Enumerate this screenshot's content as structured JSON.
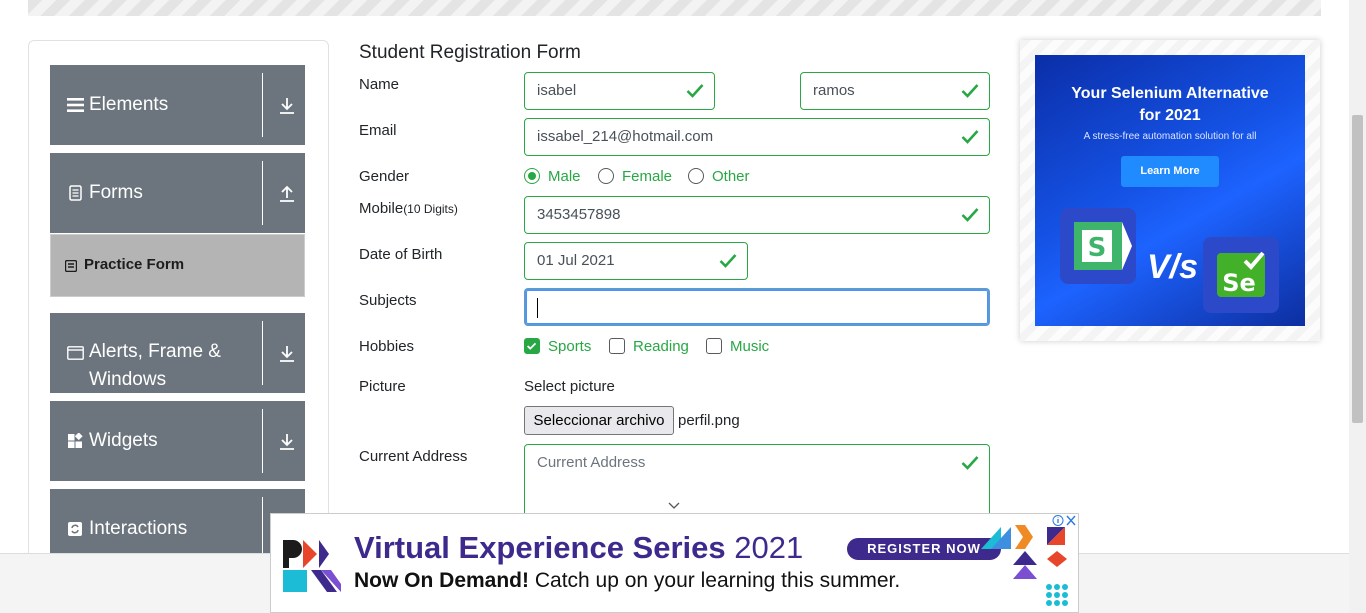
{
  "form": {
    "title": "Student Registration Form",
    "name_label": "Name",
    "first_name": "isabel",
    "last_name": "ramos",
    "email_label": "Email",
    "email": "issabel_214@hotmail.com",
    "gender_label": "Gender",
    "gender_options": [
      "Male",
      "Female",
      "Other"
    ],
    "gender_selected": "Male",
    "mobile_label": "Mobile",
    "mobile_hint": "(10 Digits)",
    "mobile": "3453457898",
    "dob_label": "Date of Birth",
    "dob": "01 Jul 2021",
    "subjects_label": "Subjects",
    "subjects_value": "",
    "hobbies_label": "Hobbies",
    "hobbies": [
      {
        "label": "Sports",
        "checked": true
      },
      {
        "label": "Reading",
        "checked": false
      },
      {
        "label": "Music",
        "checked": false
      }
    ],
    "picture_label": "Picture",
    "select_picture": "Select picture",
    "file_button": "Seleccionar archivo",
    "file_name": "perfil.png",
    "address_label": "Current Address",
    "address_placeholder": "Current Address"
  },
  "sidebar": {
    "groups": [
      {
        "label": "Elements",
        "icon": "menu-icon",
        "arrow": "down"
      },
      {
        "label": "Forms",
        "icon": "document-icon",
        "arrow": "up"
      },
      {
        "label": "Alerts, Frame &",
        "label2": "Windows",
        "icon": "window-icon",
        "arrow": "down"
      },
      {
        "label": "Widgets",
        "icon": "widgets-icon",
        "arrow": "down"
      },
      {
        "label": "Interactions",
        "icon": "refresh-icon",
        "arrow": "down"
      }
    ],
    "active_item": "Practice Form"
  },
  "ad_side": {
    "headline1": "Your Selenium Alternative",
    "headline2": "for 2021",
    "sub": "A stress-free automation solution for all",
    "button": "Learn More",
    "vs": "V/s",
    "katalon_letter": "S",
    "selenium_letter": "Se"
  },
  "ad_bottom": {
    "title": "Virtual Experience Series",
    "year": "2021",
    "register": "REGISTER NOW",
    "line2_bold": "Now On Demand!",
    "line2_rest": " Catch up on your learning this summer."
  },
  "colors": {
    "accent_green": "#28a745",
    "sidebar_gray": "#6c757d",
    "focus_blue": "#80bdff",
    "ad_purple": "#3e2a8c"
  }
}
